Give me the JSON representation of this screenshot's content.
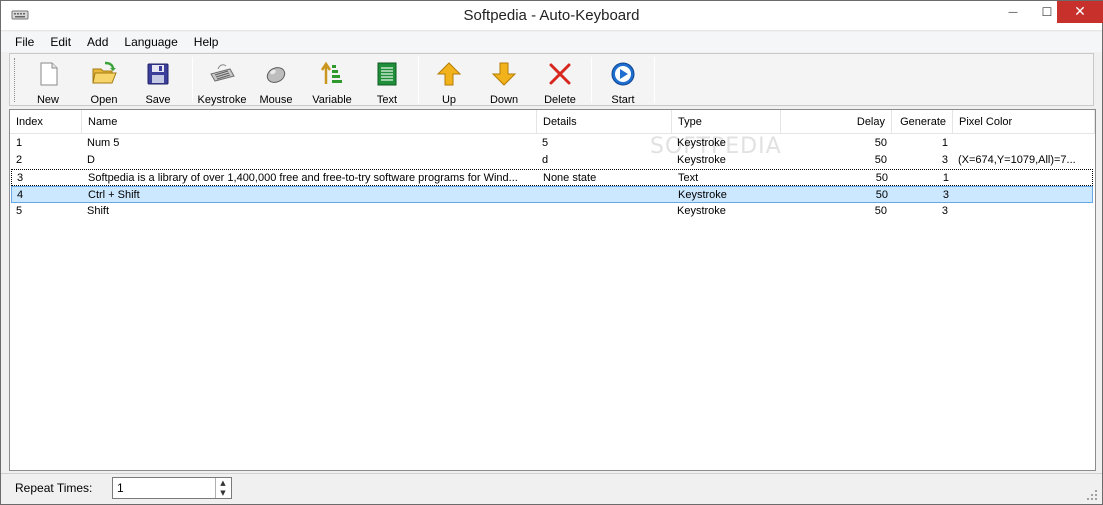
{
  "window": {
    "title": "Softpedia - Auto-Keyboard",
    "close_symbol": "✕",
    "minimize_symbol": "—",
    "maximize_symbol": "☐"
  },
  "menu": [
    {
      "label": "File"
    },
    {
      "label": "Edit"
    },
    {
      "label": "Add"
    },
    {
      "label": "Language"
    },
    {
      "label": "Help"
    }
  ],
  "toolbar": {
    "new": "New",
    "open": "Open",
    "save": "Save",
    "keystroke": "Keystroke",
    "mouse": "Mouse",
    "variable": "Variable",
    "text": "Text",
    "up": "Up",
    "down": "Down",
    "delete": "Delete",
    "start": "Start"
  },
  "columns": {
    "index": "Index",
    "name": "Name",
    "details": "Details",
    "type": "Type",
    "delay": "Delay",
    "generate": "Generate",
    "pixel_color": "Pixel Color"
  },
  "rows": [
    {
      "index": "1",
      "name": "Num 5",
      "details": "5",
      "type": "Keystroke",
      "delay": "50",
      "generate": "1",
      "pixel_color": ""
    },
    {
      "index": "2",
      "name": "D",
      "details": "d",
      "type": "Keystroke",
      "delay": "50",
      "generate": "3",
      "pixel_color": "(X=674,Y=1079,All)=7..."
    },
    {
      "index": "3",
      "name": "Softpedia is a library of over 1,400,000 free and free-to-try software programs for Wind...",
      "details": "None state",
      "type": "Text",
      "delay": "50",
      "generate": "1",
      "pixel_color": ""
    },
    {
      "index": "4",
      "name": "Ctrl + Shift",
      "details": "",
      "type": "Keystroke",
      "delay": "50",
      "generate": "3",
      "pixel_color": ""
    },
    {
      "index": "5",
      "name": "Shift",
      "details": "",
      "type": "Keystroke",
      "delay": "50",
      "generate": "3",
      "pixel_color": ""
    }
  ],
  "watermark": "SOFTPEDIA",
  "status": {
    "repeat_label": "Repeat Times:",
    "repeat_value": "1"
  },
  "colors": {
    "selection": "#cce8ff",
    "close_button": "#c7302b"
  }
}
